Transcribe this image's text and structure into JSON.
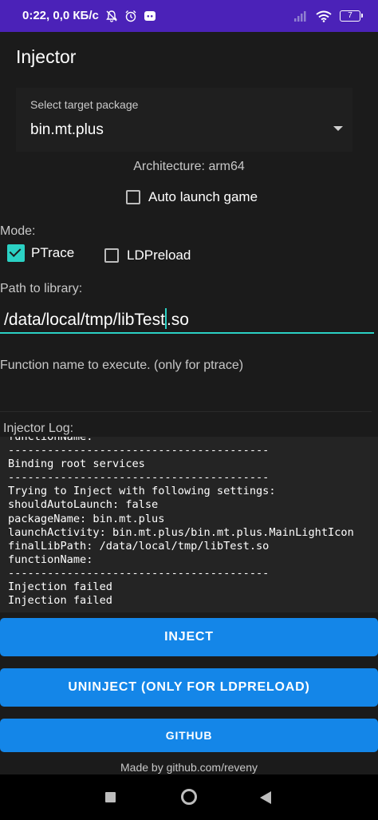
{
  "status_bar": {
    "time": "0:22",
    "network_speed": "0,0 КБ/с",
    "battery_level": "7",
    "icons_left": [
      "mute-bell-icon",
      "alarm-icon",
      "discord-icon"
    ],
    "icons_right": [
      "signal-icon",
      "wifi-icon",
      "battery-icon"
    ]
  },
  "app": {
    "title": "Injector"
  },
  "target": {
    "caption": "Select target package",
    "selected": "bin.mt.plus",
    "architecture": "Architecture: arm64"
  },
  "options": {
    "auto_launch_label": "Auto launch game",
    "auto_launch_checked": false,
    "mode_label": "Mode:",
    "ptrace_label": "PTrace",
    "ptrace_checked": true,
    "ldpreload_label": "LDPreload",
    "ldpreload_checked": false
  },
  "library": {
    "label": "Path to library:",
    "value_before_caret": "/data/local/tmp/libTest",
    "value_after_caret": ".so"
  },
  "function": {
    "placeholder": "Function name to execute. (only for ptrace)"
  },
  "log": {
    "title": "Injector Log:",
    "text": "functionName:\n----------------------------------------\nBinding root services\n----------------------------------------\nTrying to Inject with following settings:\nshouldAutoLaunch: false\npackageName: bin.mt.plus\nlaunchActivity: bin.mt.plus/bin.mt.plus.MainLightIcon\nfinalLibPath: /data/local/tmp/libTest.so\nfunctionName:\n----------------------------------------\nInjection failed\nInjection failed"
  },
  "buttons": {
    "inject": "INJECT",
    "uninject": "UNINJECT (ONLY FOR LDPRELOAD)",
    "github": "GITHUB"
  },
  "footer": {
    "made_by": "Made by github.com/reveny"
  },
  "colors": {
    "status_bar": "#4b22b8",
    "background": "#1b1b1b",
    "accent": "#2bd1c4",
    "button": "#1486e8"
  }
}
